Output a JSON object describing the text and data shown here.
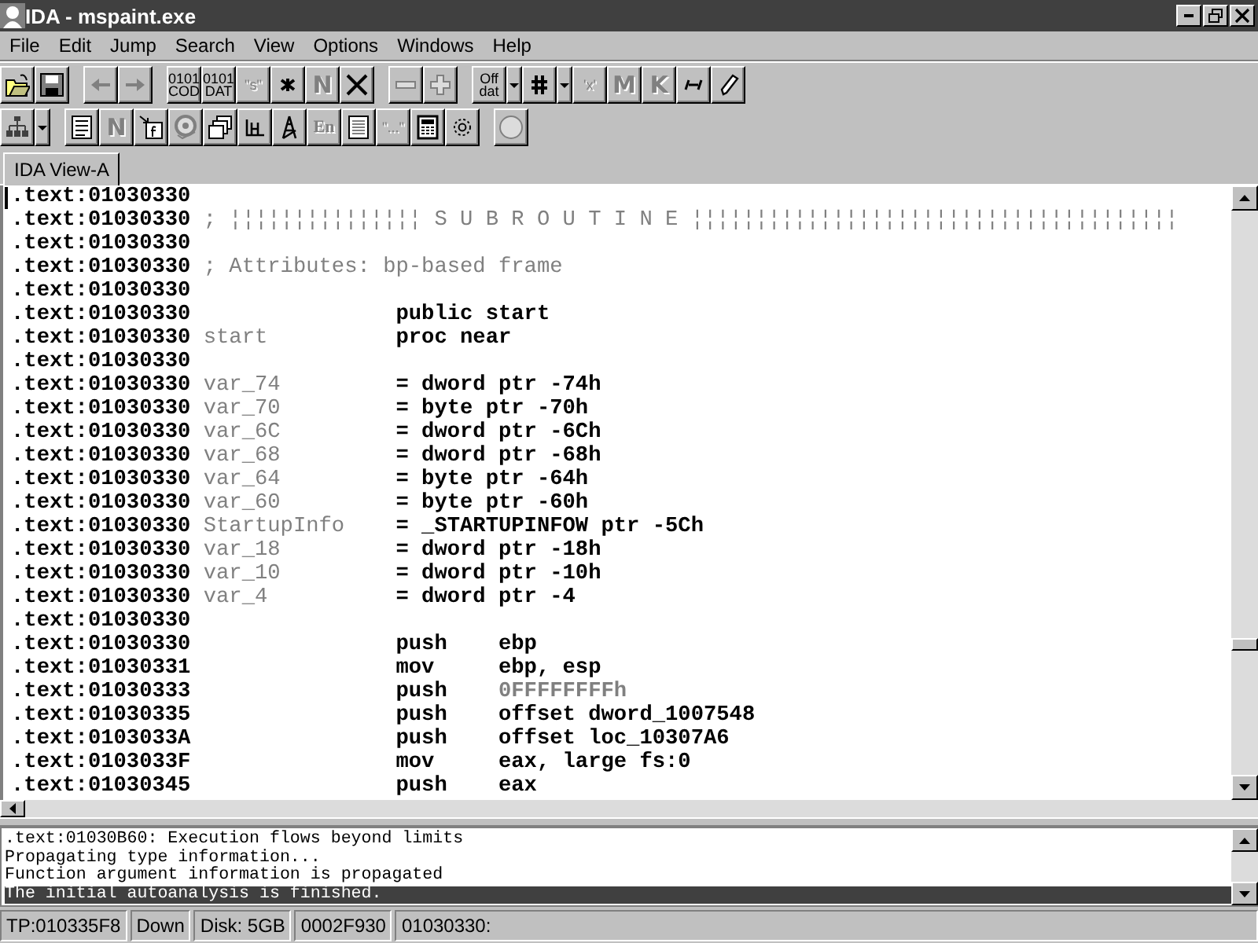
{
  "window": {
    "title": "IDA - mspaint.exe"
  },
  "menu": [
    "File",
    "Edit",
    "Jump",
    "Search",
    "View",
    "Options",
    "Windows",
    "Help"
  ],
  "toolbars": [
    {
      "groups": [
        {
          "buttons": [
            {
              "kind": "open-folder",
              "disabled": false
            },
            {
              "kind": "floppy",
              "disabled": false
            }
          ]
        },
        {
          "buttons": [
            {
              "kind": "arrow-left",
              "disabled": true
            },
            {
              "kind": "arrow-right",
              "disabled": true
            }
          ]
        },
        {
          "buttons": [
            {
              "kind": "text",
              "lines": [
                "0101",
                "COD"
              ],
              "disabled": false
            },
            {
              "kind": "text",
              "lines": [
                "0101",
                "DAT"
              ],
              "disabled": false
            },
            {
              "kind": "text",
              "lines": [
                "\"s\""
              ],
              "disabled": true
            },
            {
              "kind": "asterisk",
              "disabled": false
            },
            {
              "kind": "big-letter",
              "lines": [
                "N"
              ],
              "disabled": true
            },
            {
              "kind": "cross",
              "disabled": false
            }
          ]
        },
        {
          "buttons": [
            {
              "kind": "minus",
              "disabled": true
            },
            {
              "kind": "plus",
              "disabled": true
            }
          ]
        },
        {
          "buttons": [
            {
              "kind": "text",
              "lines": [
                "Off",
                "dat"
              ],
              "disabled": false
            },
            {
              "kind": "dropdown",
              "disabled": false
            },
            {
              "kind": "hash",
              "disabled": false
            },
            {
              "kind": "dropdown",
              "disabled": false
            },
            {
              "kind": "text",
              "lines": [
                "'x'"
              ],
              "disabled": true
            },
            {
              "kind": "big-letter",
              "lines": [
                "M"
              ],
              "disabled": true
            },
            {
              "kind": "big-letter",
              "lines": [
                "K"
              ],
              "disabled": true
            },
            {
              "kind": "slash-bar",
              "disabled": false
            },
            {
              "kind": "pencil",
              "disabled": false
            }
          ]
        }
      ]
    },
    {
      "groups": [
        {
          "buttons": [
            {
              "kind": "tree",
              "disabled": false
            },
            {
              "kind": "dropdown",
              "disabled": false
            }
          ]
        },
        {
          "buttons": [
            {
              "kind": "document",
              "disabled": false
            },
            {
              "kind": "big-letter",
              "lines": [
                "N"
              ],
              "disabled": true
            },
            {
              "kind": "function-arrow",
              "disabled": false
            },
            {
              "kind": "disc",
              "disabled": true
            },
            {
              "kind": "windows",
              "disabled": false
            },
            {
              "kind": "graph",
              "disabled": false
            },
            {
              "kind": "tower",
              "disabled": false
            },
            {
              "kind": "big-letter",
              "lines": [
                "En"
              ],
              "disabled": true
            },
            {
              "kind": "notes",
              "disabled": false
            },
            {
              "kind": "text",
              "lines": [
                "\"...\""
              ],
              "disabled": true
            },
            {
              "kind": "calculator",
              "disabled": false
            },
            {
              "kind": "flower",
              "disabled": false
            }
          ]
        },
        {
          "buttons": [
            {
              "kind": "circle",
              "disabled": true
            }
          ]
        }
      ]
    }
  ],
  "tabs": [
    {
      "label": "IDA View-A",
      "selected": true
    }
  ],
  "code_lines": [
    {
      "kind": "blank",
      "address": ".text:01030330"
    },
    {
      "kind": "comment",
      "address": ".text:01030330",
      "comment": "; ¦¦¦¦¦¦¦¦¦¦¦¦¦¦¦ S U B R O U T I N E ¦¦¦¦¦¦¦¦¦¦¦¦¦¦¦¦¦¦¦¦¦¦¦¦¦¦¦¦¦¦¦¦¦¦¦¦¦¦"
    },
    {
      "kind": "blank",
      "address": ".text:01030330"
    },
    {
      "kind": "comment",
      "address": ".text:01030330",
      "comment": "; Attributes: bp-based frame"
    },
    {
      "kind": "blank",
      "address": ".text:01030330"
    },
    {
      "kind": "code",
      "address": ".text:01030330",
      "mnemonic": "public start"
    },
    {
      "kind": "code",
      "address": ".text:01030330",
      "label": "start",
      "mnemonic": "proc near"
    },
    {
      "kind": "blank",
      "address": ".text:01030330"
    },
    {
      "kind": "data",
      "address": ".text:01030330",
      "label": "var_74",
      "definition": "= dword ptr -74h"
    },
    {
      "kind": "data",
      "address": ".text:01030330",
      "label": "var_70",
      "definition": "= byte ptr -70h"
    },
    {
      "kind": "data",
      "address": ".text:01030330",
      "label": "var_6C",
      "definition": "= dword ptr -6Ch"
    },
    {
      "kind": "data",
      "address": ".text:01030330",
      "label": "var_68",
      "definition": "= dword ptr -68h"
    },
    {
      "kind": "data",
      "address": ".text:01030330",
      "label": "var_64",
      "definition": "= byte ptr -64h"
    },
    {
      "kind": "data",
      "address": ".text:01030330",
      "label": "var_60",
      "definition": "= byte ptr -60h"
    },
    {
      "kind": "data",
      "address": ".text:01030330",
      "label": "StartupInfo",
      "definition": "= _STARTUPINFOW ptr -5Ch"
    },
    {
      "kind": "data",
      "address": ".text:01030330",
      "label": "var_18",
      "definition": "= dword ptr -18h"
    },
    {
      "kind": "data",
      "address": ".text:01030330",
      "label": "var_10",
      "definition": "= dword ptr -10h"
    },
    {
      "kind": "data",
      "address": ".text:01030330",
      "label": "var_4",
      "definition": "= dword ptr -4"
    },
    {
      "kind": "blank",
      "address": ".text:01030330"
    },
    {
      "kind": "code",
      "address": ".text:01030330",
      "mnemonic": "push",
      "operands": {
        "kind": "symbol",
        "text": "ebp"
      }
    },
    {
      "kind": "code",
      "address": ".text:01030331",
      "mnemonic": "mov",
      "operands": {
        "kind": "symbol",
        "text": "ebp, esp"
      }
    },
    {
      "kind": "code",
      "address": ".text:01030333",
      "mnemonic": "push",
      "operands": {
        "kind": "number",
        "text": "0FFFFFFFFh"
      }
    },
    {
      "kind": "code",
      "address": ".text:01030335",
      "mnemonic": "push",
      "operands": {
        "kind": "symbol",
        "text": "offset dword_1007548"
      }
    },
    {
      "kind": "code",
      "address": ".text:0103033A",
      "mnemonic": "push",
      "operands": {
        "kind": "symbol",
        "text": "offset loc_10307A6"
      }
    },
    {
      "kind": "code",
      "address": ".text:0103033F",
      "mnemonic": "mov",
      "operands": {
        "kind": "symbol",
        "text": "eax, large fs:0"
      }
    },
    {
      "kind": "code",
      "address": ".text:01030345",
      "mnemonic": "push",
      "operands": {
        "kind": "symbol",
        "text": "eax"
      }
    }
  ],
  "log": [
    {
      "text": ".text:01030B60: Execution flows beyond limits",
      "selected": false
    },
    {
      "text": "Propagating type information...",
      "selected": false
    },
    {
      "text": "Function argument information is propagated",
      "selected": false
    },
    {
      "text": "The initial autoanalysis is finished.",
      "selected": true
    }
  ],
  "status_bar": [
    "TP:010335F8",
    "Down",
    "Disk: 5GB",
    "0002F930",
    "01030330:"
  ]
}
